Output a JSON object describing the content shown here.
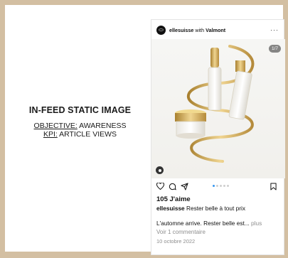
{
  "left_panel": {
    "headline": "IN-FEED STATIC IMAGE",
    "objective_label": "OBJECTIVE:",
    "objective_value": "AWARENESS",
    "kpi_label": "KPI:",
    "kpi_value": "ARTICLE VIEWS"
  },
  "post": {
    "username": "ellesuisse",
    "with_text": "with",
    "partner": "Valmont",
    "more": "···",
    "counter": "1/7",
    "likes": "105 J'aime",
    "caption_user": "ellesuisse",
    "caption_text": "Rester belle à tout prix",
    "caption_line2": "L'automne arrive. Rester belle est...",
    "more_link": "plus",
    "comments": "Voir 1 commentaire",
    "date": "10 octobre 2022",
    "carousel_dots": 5,
    "active_dot": 1
  },
  "colors": {
    "background": "#d3bfa2",
    "accent_dot": "#3897f0",
    "gold": "#c9a255"
  },
  "icons": [
    "heart-icon",
    "comment-icon",
    "share-icon",
    "bookmark-icon",
    "user-tag-icon",
    "more-icon"
  ]
}
